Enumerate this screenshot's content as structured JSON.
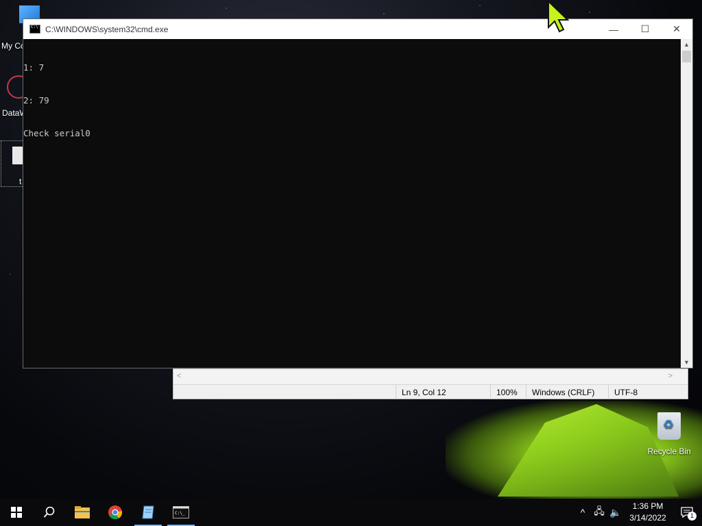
{
  "desktop": {
    "icons": [
      {
        "label": "My Co"
      },
      {
        "label": "DataW"
      },
      {
        "label": "t"
      },
      {
        "label": "Recycle Bin"
      }
    ]
  },
  "cmd_window": {
    "title": "C:\\WINDOWS\\system32\\cmd.exe",
    "console_lines": [
      "1: 7",
      "2: 79",
      "Check serial0"
    ],
    "caption": {
      "minimize": "—",
      "maximize": "☐",
      "close": "✕"
    }
  },
  "notepad_window": {
    "status": {
      "position": "Ln 9, Col 12",
      "zoom": "100%",
      "line_ending": "Windows (CRLF)",
      "encoding": "UTF-8"
    }
  },
  "taskbar": {
    "apps": [
      {
        "name": "file-explorer-icon"
      },
      {
        "name": "chrome-icon"
      },
      {
        "name": "notepad-icon"
      },
      {
        "name": "cmd-icon"
      }
    ],
    "tray": {
      "chevron": "^",
      "time": "1:36 PM",
      "date": "3/14/2022",
      "notifications": "1"
    }
  }
}
